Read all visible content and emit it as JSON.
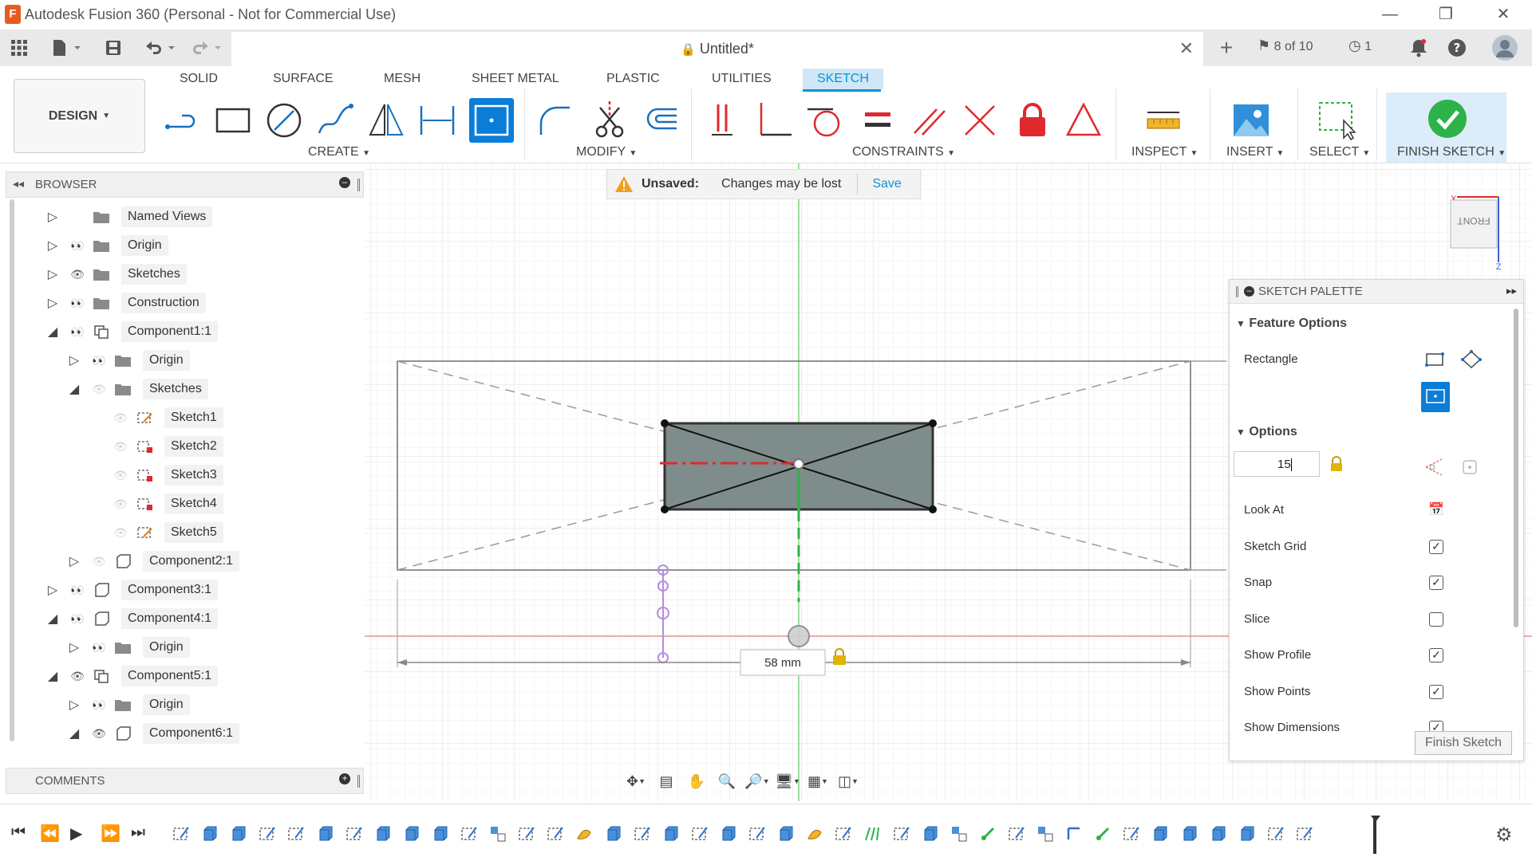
{
  "window": {
    "app_icon": "F",
    "title": "Autodesk Fusion 360 (Personal - Not for Commercial Use)",
    "minimize": "—",
    "restore": "❐",
    "close": "✕"
  },
  "tabbar": {
    "doc_title": "Untitled*",
    "jobs": "8 of 10",
    "clock_count": "1"
  },
  "ribbon": {
    "workspace": "DESIGN",
    "tabs": [
      "SOLID",
      "SURFACE",
      "MESH",
      "SHEET METAL",
      "PLASTIC",
      "UTILITIES",
      "SKETCH"
    ],
    "active_tab": "SKETCH",
    "groups": {
      "create": "CREATE",
      "modify": "MODIFY",
      "constraints": "CONSTRAINTS",
      "inspect": "INSPECT",
      "insert": "INSERT",
      "select": "SELECT",
      "finish": "FINISH SKETCH"
    }
  },
  "browser": {
    "title": "BROWSER",
    "items": [
      {
        "label": "Named Views",
        "depth": 0,
        "expanded": false,
        "eye": "none",
        "icon": "folder"
      },
      {
        "label": "Origin",
        "depth": 0,
        "expanded": false,
        "eye": "hidden",
        "icon": "folder"
      },
      {
        "label": "Sketches",
        "depth": 0,
        "expanded": false,
        "eye": "visible",
        "icon": "folder"
      },
      {
        "label": "Construction",
        "depth": 0,
        "expanded": false,
        "eye": "hidden",
        "icon": "folder"
      },
      {
        "label": "Component1:1",
        "depth": 0,
        "expanded": true,
        "eye": "hidden",
        "icon": "component"
      },
      {
        "label": "Origin",
        "depth": 1,
        "expanded": false,
        "eye": "hidden",
        "icon": "folder"
      },
      {
        "label": "Sketches",
        "depth": 1,
        "expanded": true,
        "eye": "faint",
        "icon": "folder"
      },
      {
        "label": "Sketch1",
        "depth": 2,
        "expanded": null,
        "eye": "faint",
        "icon": "sketch"
      },
      {
        "label": "Sketch2",
        "depth": 2,
        "expanded": null,
        "eye": "faint",
        "icon": "sketch-lock"
      },
      {
        "label": "Sketch3",
        "depth": 2,
        "expanded": null,
        "eye": "faint",
        "icon": "sketch-lock"
      },
      {
        "label": "Sketch4",
        "depth": 2,
        "expanded": null,
        "eye": "faint",
        "icon": "sketch-lock"
      },
      {
        "label": "Sketch5",
        "depth": 2,
        "expanded": null,
        "eye": "faint",
        "icon": "sketch"
      },
      {
        "label": "Component2:1",
        "depth": 1,
        "expanded": false,
        "eye": "faint",
        "icon": "body"
      },
      {
        "label": "Component3:1",
        "depth": 0,
        "expanded": false,
        "eye": "hidden",
        "icon": "body"
      },
      {
        "label": "Component4:1",
        "depth": 0,
        "expanded": true,
        "eye": "hidden",
        "icon": "body"
      },
      {
        "label": "Origin",
        "depth": 1,
        "expanded": false,
        "eye": "hidden",
        "icon": "folder"
      },
      {
        "label": "Component5:1",
        "depth": 0,
        "expanded": true,
        "eye": "visible",
        "icon": "component"
      },
      {
        "label": "Origin",
        "depth": 1,
        "expanded": false,
        "eye": "hidden",
        "icon": "folder"
      },
      {
        "label": "Component6:1",
        "depth": 1,
        "expanded": true,
        "eye": "visible",
        "icon": "body"
      }
    ]
  },
  "comments": {
    "title": "COMMENTS"
  },
  "banner": {
    "status": "Unsaved:",
    "message": "Changes may be lost",
    "save": "Save"
  },
  "canvas": {
    "dimension": "58 mm"
  },
  "palette": {
    "title": "SKETCH PALETTE",
    "feature_options": "Feature Options",
    "rectangle": "Rectangle",
    "options": "Options",
    "input_value": "15",
    "rows": [
      {
        "label": "Look At",
        "type": "button"
      },
      {
        "label": "Sketch Grid",
        "checked": true
      },
      {
        "label": "Snap",
        "checked": true
      },
      {
        "label": "Slice",
        "checked": false
      },
      {
        "label": "Show Profile",
        "checked": true
      },
      {
        "label": "Show Points",
        "checked": true
      },
      {
        "label": "Show Dimensions",
        "checked": true
      }
    ],
    "finish_button": "Finish Sketch"
  },
  "viewcube": {
    "face": "FRONT",
    "axis_x": "X",
    "axis_z": "Z"
  },
  "colors": {
    "accent": "#0696d7",
    "active_tool": "#0a7dd8",
    "finish_green": "#2db34a",
    "constraint_red": "#e0292f",
    "sketch_fill": "#7f8c8c"
  }
}
